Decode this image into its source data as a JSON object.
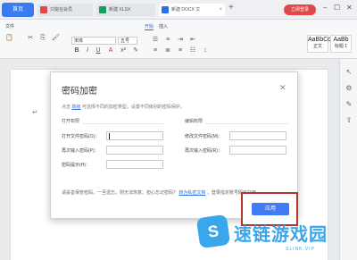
{
  "titlebar": {
    "home_label": "首页",
    "tabs": [
      {
        "label": "只能在会员",
        "icon_color": "#e0484c"
      },
      {
        "label": "新建 XLSX",
        "icon_color": "#1a9e5c"
      },
      {
        "label": "新建 DOCX 文",
        "icon_color": "#2d6fe0",
        "active": true
      }
    ],
    "new_tab": "+",
    "login_label": "立即登录"
  },
  "ribbon": {
    "menus": [
      "文件",
      "开始",
      "插入",
      "页面布局",
      "引用",
      "审阅",
      "视图",
      "章节",
      "开发工具"
    ],
    "active_menu": "开始",
    "font_name": "宋体",
    "font_size": "五号",
    "styles": [
      {
        "sample": "AaBbCcDd",
        "name": "正文"
      },
      {
        "sample": "AaBb",
        "name": "标题 1"
      }
    ]
  },
  "dialog": {
    "title": "密码加密",
    "close": "✕",
    "hint_prefix": "点击",
    "hint_link": "高级",
    "hint_suffix": "可选择不同的加密类型，设置不同级别的密码保护。",
    "open_section": {
      "title": "打开权限",
      "fields": [
        {
          "label": "打开文件密码(O)：",
          "value": ""
        },
        {
          "label": "再次输入密码(P)：",
          "value": ""
        },
        {
          "label": "密码提示(H)：",
          "value": ""
        }
      ]
    },
    "edit_section": {
      "title": "编辑权限",
      "fields": [
        {
          "label": "修改文件密码(M)：",
          "value": ""
        },
        {
          "label": "再次输入密码(R)：",
          "value": ""
        }
      ]
    },
    "note_prefix": "请妥善保管密码，一旦遗忘，则无法恢复。担心忘记密码？",
    "note_link": "转为私密文档",
    "note_suffix": "，登录指定账号即可打开。",
    "apply_label": "应用"
  },
  "watermark": {
    "logo_glyph": "S",
    "text": "速链游戏园",
    "sub": "SLINK.VIP"
  },
  "colors": {
    "accent": "#3e7bf4",
    "highlight_border": "#b3342c",
    "login": "#e0484c"
  }
}
